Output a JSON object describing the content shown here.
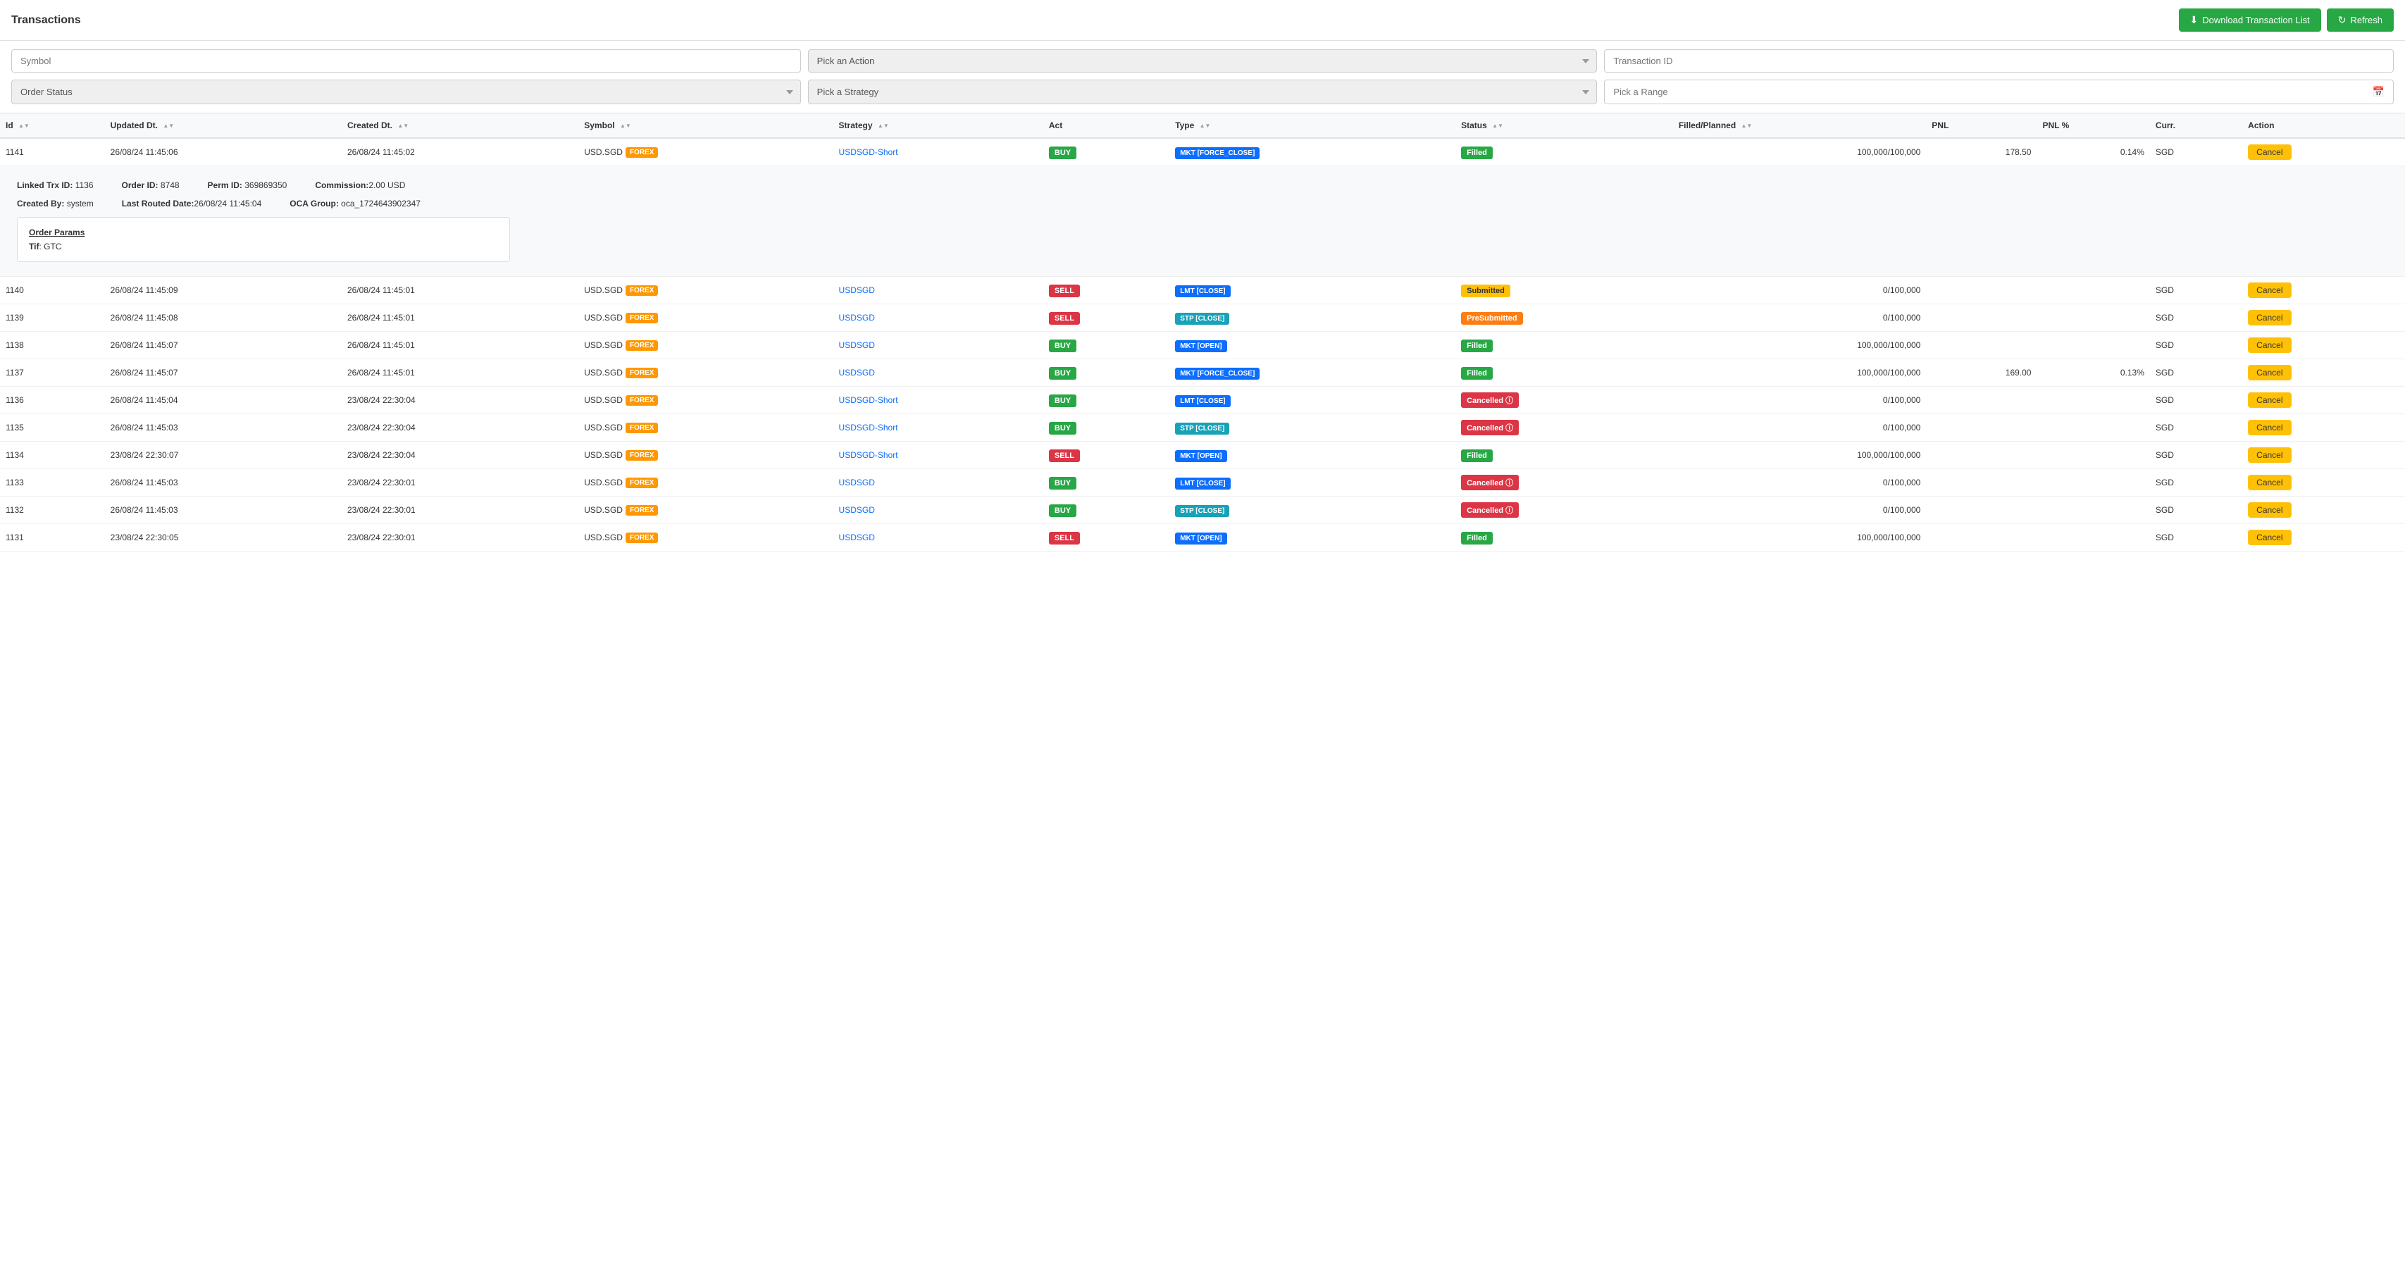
{
  "header": {
    "title": "Transactions",
    "download_label": "Download Transaction List",
    "refresh_label": "Refresh"
  },
  "filters": {
    "symbol_placeholder": "Symbol",
    "action_placeholder": "Pick an Action",
    "transaction_id_placeholder": "Transaction ID",
    "order_status_placeholder": "Order Status",
    "strategy_placeholder": "Pick a Strategy",
    "range_placeholder": "Pick a Range"
  },
  "table": {
    "columns": [
      "Id",
      "Updated Dt.",
      "Created Dt.",
      "Symbol",
      "Strategy",
      "Act",
      "Type",
      "Status",
      "Filled/Planned",
      "PNL",
      "PNL %",
      "Curr.",
      "Action"
    ],
    "expanded_row_id": 1141,
    "expanded": {
      "linked_trx_id": "1136",
      "order_id": "8748",
      "perm_id": "369869350",
      "commission": "2.00 USD",
      "created_by": "system",
      "last_routed_date": "26/08/24 11:45:04",
      "oca_group": "oca_1724643902347",
      "order_params_title": "Order Params",
      "tif_label": "Tif",
      "tif_value": "GTC"
    },
    "rows": [
      {
        "id": 1141,
        "updated_dt": "26/08/24 11:45:06",
        "created_dt": "26/08/24 11:45:02",
        "symbol": "USD.SGD",
        "symbol_type": "FOREX",
        "strategy": "USDSGD-Short",
        "strategy_link": true,
        "act": "BUY",
        "type": "MKT [FORCE_CLOSE]",
        "type_class": "type-mkt-force",
        "status": "Filled",
        "status_class": "status-filled",
        "filled_planned": "100,000/100,000",
        "pnl": "178.50",
        "pnl_pct": "0.14%",
        "curr": "SGD",
        "action": "Cancel",
        "expanded": true
      },
      {
        "id": 1140,
        "updated_dt": "26/08/24 11:45:09",
        "created_dt": "26/08/24 11:45:01",
        "symbol": "USD.SGD",
        "symbol_type": "FOREX",
        "strategy": "USDSGD",
        "strategy_link": true,
        "act": "SELL",
        "type": "LMT [CLOSE]",
        "type_class": "type-lmt-close",
        "status": "Submitted",
        "status_class": "status-submitted",
        "filled_planned": "0/100,000",
        "pnl": "",
        "pnl_pct": "",
        "curr": "SGD",
        "action": "Cancel",
        "expanded": false
      },
      {
        "id": 1139,
        "updated_dt": "26/08/24 11:45:08",
        "created_dt": "26/08/24 11:45:01",
        "symbol": "USD.SGD",
        "symbol_type": "FOREX",
        "strategy": "USDSGD",
        "strategy_link": true,
        "act": "SELL",
        "type": "STP [CLOSE]",
        "type_class": "type-stp-close",
        "status": "PreSubmitted",
        "status_class": "status-presubmitted",
        "filled_planned": "0/100,000",
        "pnl": "",
        "pnl_pct": "",
        "curr": "SGD",
        "action": "Cancel",
        "expanded": false
      },
      {
        "id": 1138,
        "updated_dt": "26/08/24 11:45:07",
        "created_dt": "26/08/24 11:45:01",
        "symbol": "USD.SGD",
        "symbol_type": "FOREX",
        "strategy": "USDSGD",
        "strategy_link": true,
        "act": "BUY",
        "type": "MKT [OPEN]",
        "type_class": "type-mkt-open",
        "status": "Filled",
        "status_class": "status-filled",
        "filled_planned": "100,000/100,000",
        "pnl": "",
        "pnl_pct": "",
        "curr": "SGD",
        "action": "Cancel",
        "expanded": false
      },
      {
        "id": 1137,
        "updated_dt": "26/08/24 11:45:07",
        "created_dt": "26/08/24 11:45:01",
        "symbol": "USD.SGD",
        "symbol_type": "FOREX",
        "strategy": "USDSGD",
        "strategy_link": true,
        "act": "BUY",
        "type": "MKT [FORCE_CLOSE]",
        "type_class": "type-mkt-force",
        "status": "Filled",
        "status_class": "status-filled",
        "filled_planned": "100,000/100,000",
        "pnl": "169.00",
        "pnl_pct": "0.13%",
        "curr": "SGD",
        "action": "Cancel",
        "expanded": false
      },
      {
        "id": 1136,
        "updated_dt": "26/08/24 11:45:04",
        "created_dt": "23/08/24 22:30:04",
        "symbol": "USD.SGD",
        "symbol_type": "FOREX",
        "strategy": "USDSGD-Short",
        "strategy_link": true,
        "act": "BUY",
        "type": "LMT [CLOSE]",
        "type_class": "type-lmt-close",
        "status": "Cancelled",
        "status_class": "status-cancelled",
        "filled_planned": "0/100,000",
        "pnl": "",
        "pnl_pct": "",
        "curr": "SGD",
        "action": "Cancel",
        "expanded": false
      },
      {
        "id": 1135,
        "updated_dt": "26/08/24 11:45:03",
        "created_dt": "23/08/24 22:30:04",
        "symbol": "USD.SGD",
        "symbol_type": "FOREX",
        "strategy": "USDSGD-Short",
        "strategy_link": true,
        "act": "BUY",
        "type": "STP [CLOSE]",
        "type_class": "type-stp-close",
        "status": "Cancelled",
        "status_class": "status-cancelled",
        "filled_planned": "0/100,000",
        "pnl": "",
        "pnl_pct": "",
        "curr": "SGD",
        "action": "Cancel",
        "expanded": false
      },
      {
        "id": 1134,
        "updated_dt": "23/08/24 22:30:07",
        "created_dt": "23/08/24 22:30:04",
        "symbol": "USD.SGD",
        "symbol_type": "FOREX",
        "strategy": "USDSGD-Short",
        "strategy_link": true,
        "act": "SELL",
        "type": "MKT [OPEN]",
        "type_class": "type-mkt-open",
        "status": "Filled",
        "status_class": "status-filled",
        "filled_planned": "100,000/100,000",
        "pnl": "",
        "pnl_pct": "",
        "curr": "SGD",
        "action": "Cancel",
        "expanded": false
      },
      {
        "id": 1133,
        "updated_dt": "26/08/24 11:45:03",
        "created_dt": "23/08/24 22:30:01",
        "symbol": "USD.SGD",
        "symbol_type": "FOREX",
        "strategy": "USDSGD",
        "strategy_link": true,
        "act": "BUY",
        "type": "LMT [CLOSE]",
        "type_class": "type-lmt-close",
        "status": "Cancelled",
        "status_class": "status-cancelled",
        "filled_planned": "0/100,000",
        "pnl": "",
        "pnl_pct": "",
        "curr": "SGD",
        "action": "Cancel",
        "expanded": false
      },
      {
        "id": 1132,
        "updated_dt": "26/08/24 11:45:03",
        "created_dt": "23/08/24 22:30:01",
        "symbol": "USD.SGD",
        "symbol_type": "FOREX",
        "strategy": "USDSGD",
        "strategy_link": true,
        "act": "BUY",
        "type": "STP [CLOSE]",
        "type_class": "type-stp-close",
        "status": "Cancelled",
        "status_class": "status-cancelled",
        "filled_planned": "0/100,000",
        "pnl": "",
        "pnl_pct": "",
        "curr": "SGD",
        "action": "Cancel",
        "expanded": false
      },
      {
        "id": 1131,
        "updated_dt": "23/08/24 22:30:05",
        "created_dt": "23/08/24 22:30:01",
        "symbol": "USD.SGD",
        "symbol_type": "FOREX",
        "strategy": "USDSGD",
        "strategy_link": true,
        "act": "SELL",
        "type": "MKT [OPEN]",
        "type_class": "type-mkt-open",
        "status": "Filled",
        "status_class": "status-filled",
        "filled_planned": "100,000/100,000",
        "pnl": "",
        "pnl_pct": "",
        "curr": "SGD",
        "action": "Cancel",
        "expanded": false
      }
    ]
  }
}
